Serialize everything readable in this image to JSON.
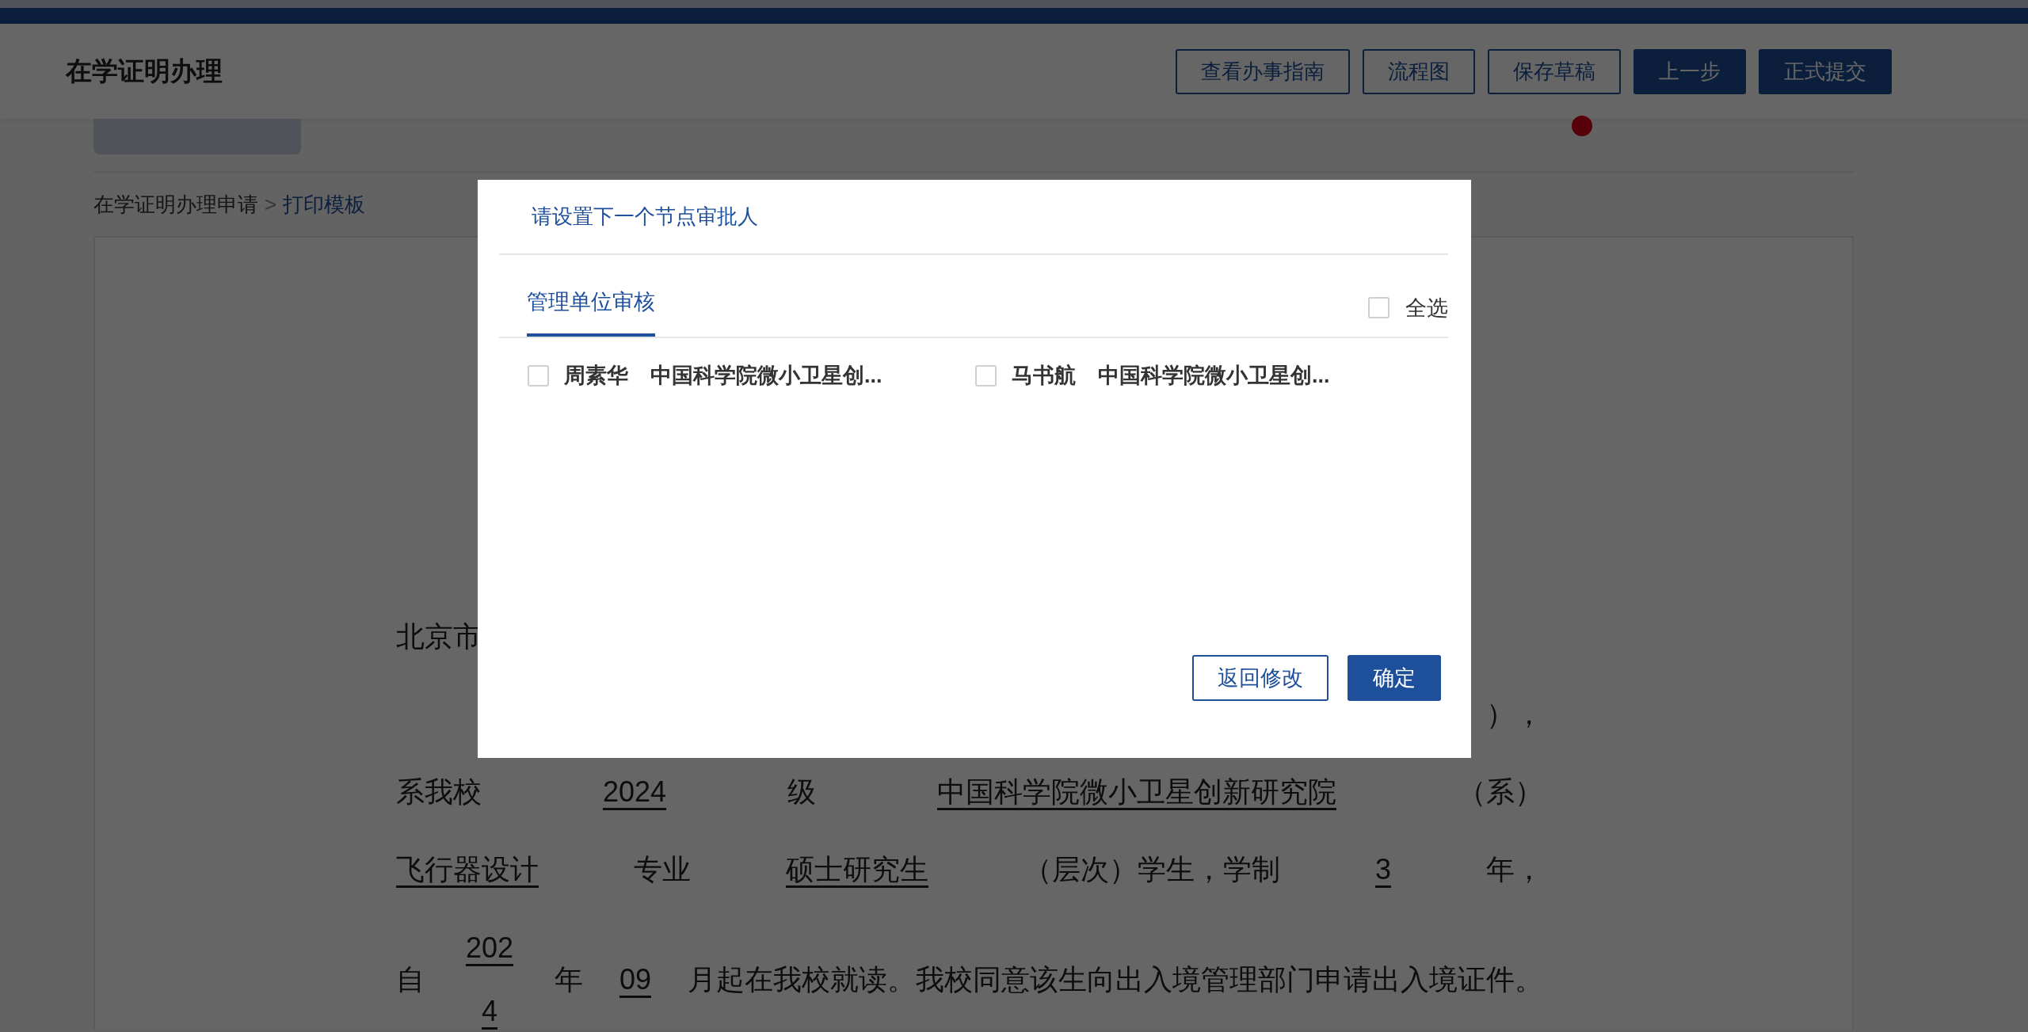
{
  "header": {
    "title": "在学证明办理",
    "buttons": [
      {
        "label": "查看办事指南",
        "kind": "outline"
      },
      {
        "label": "流程图",
        "kind": "outline"
      },
      {
        "label": "保存草稿",
        "kind": "outline"
      },
      {
        "label": "上一步",
        "kind": "primary"
      },
      {
        "label": "正式提交",
        "kind": "primary"
      }
    ]
  },
  "breadcrumb": {
    "items": [
      {
        "label": "在学证明办理申请",
        "current": false
      },
      {
        "label": "打印模板",
        "current": true
      }
    ],
    "separator": ">"
  },
  "document": {
    "lines": [
      [
        {
          "text": "北京市",
          "kind": "plain"
        }
      ],
      [
        {
          "text": "），",
          "kind": "plain"
        }
      ],
      [
        {
          "text": "系我校",
          "kind": "plain"
        },
        {
          "text": "2024",
          "kind": "blank"
        },
        {
          "text": "级",
          "kind": "plain"
        },
        {
          "text": "中国科学院微小卫星创新研究院",
          "kind": "blank"
        },
        {
          "text": "（系）",
          "kind": "plain"
        }
      ],
      [
        {
          "text": "飞行器设计",
          "kind": "blank"
        },
        {
          "text": "专业",
          "kind": "plain"
        },
        {
          "text": "硕士研究生",
          "kind": "blank"
        },
        {
          "text": "（层次）学生，学制",
          "kind": "plain"
        },
        {
          "text": "3",
          "kind": "blank"
        },
        {
          "text": "年，",
          "kind": "plain"
        }
      ],
      [
        {
          "text": "自",
          "kind": "plain"
        },
        {
          "text": "2024",
          "kind": "narrow"
        },
        {
          "text": "年",
          "kind": "plain"
        },
        {
          "text": "09",
          "kind": "blank"
        },
        {
          "text": "月起在我校就读。我校同意该生向出入境管理部门申请出入境证件。",
          "kind": "plain"
        }
      ]
    ]
  },
  "dialog": {
    "title": "请设置下一个节点审批人",
    "tabs": [
      {
        "label": "管理单位审核",
        "selected": true
      }
    ],
    "select_all": {
      "label": "全选",
      "checked": false
    },
    "approvers": [
      {
        "name": "周素华",
        "unit": "中国科学院微小卫星创...",
        "checked": false
      },
      {
        "name": "马书航",
        "unit": "中国科学院微小卫星创...",
        "checked": false
      }
    ],
    "buttons": [
      {
        "label": "返回修改",
        "kind": "outline"
      },
      {
        "label": "确定",
        "kind": "primary"
      }
    ]
  }
}
